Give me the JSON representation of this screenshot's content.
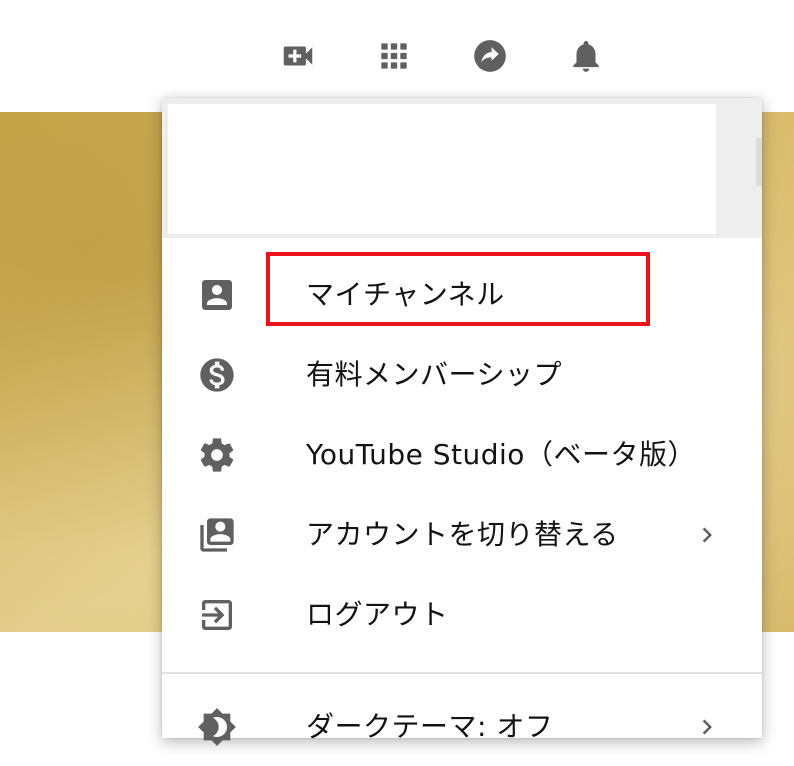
{
  "masthead": {
    "icons": [
      "video-camera-add-icon",
      "apps-grid-icon",
      "share-arrow-icon",
      "bell-icon"
    ]
  },
  "account_menu": {
    "items": [
      {
        "label": "マイチャンネル",
        "icon": "account-box-icon",
        "highlighted": true
      },
      {
        "label": "有料メンバーシップ",
        "icon": "dollar-circle-icon"
      },
      {
        "label": "YouTube Studio（ベータ版）",
        "icon": "gear-icon"
      },
      {
        "label": "アカウントを切り替える",
        "icon": "switch-account-icon",
        "has_submenu": true
      },
      {
        "label": "ログアウト",
        "icon": "exit-icon"
      }
    ],
    "partial_item": {
      "label": "ダークテーマ: オフ",
      "icon": "dark-theme-icon",
      "has_submenu": true
    }
  },
  "colors": {
    "icon_gray": "#606060",
    "highlight_red": "#e8141c",
    "banner_gold": "#d7ba6a"
  }
}
